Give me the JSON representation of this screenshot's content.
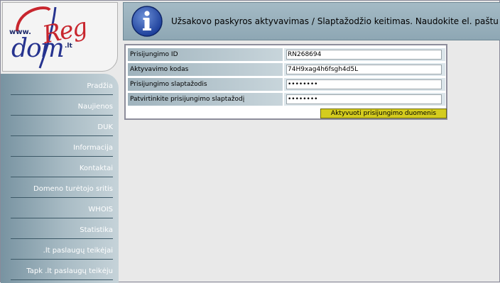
{
  "logo": {
    "www": "www.",
    "dom": "dom",
    "reg": "Reg",
    "tld": ".lt"
  },
  "sidebar": {
    "items": [
      {
        "label": "Pradžia"
      },
      {
        "label": "Naujienos"
      },
      {
        "label": "DUK"
      },
      {
        "label": "Informacija"
      },
      {
        "label": "Kontaktai"
      },
      {
        "label": "Domeno turėtojo sritis"
      },
      {
        "label": "WHOIS"
      },
      {
        "label": "Statistika"
      },
      {
        "label": ".lt paslaugų teikėjai"
      },
      {
        "label": "Tapk .lt paslaugų teikėju"
      }
    ]
  },
  "header": {
    "icon": "info-icon",
    "text": "Užsakovo paskyros aktyvavimas / Slaptažodžio keitimas. Naudokite el. paštu gautus k"
  },
  "form": {
    "fields": [
      {
        "label": "Prisijungimo ID",
        "value": "RN268694"
      },
      {
        "label": "Aktyvavimo kodas",
        "value": "74H9xag4h6fsgh4d5L"
      },
      {
        "label": "Prisijungimo slaptažodis",
        "value": "••••••••"
      },
      {
        "label": "Patvirtinkite prisijungimo slaptažodį",
        "value": "••••••••"
      }
    ],
    "submit_label": "Aktyvuoti prisijungimo duomenis"
  },
  "colors": {
    "header_bg": "#9fb6c2",
    "sidebar_bg": "#8aa3b0",
    "button_bg": "#d4cc1e",
    "logo_red": "#c8262e",
    "logo_blue": "#26338f"
  }
}
